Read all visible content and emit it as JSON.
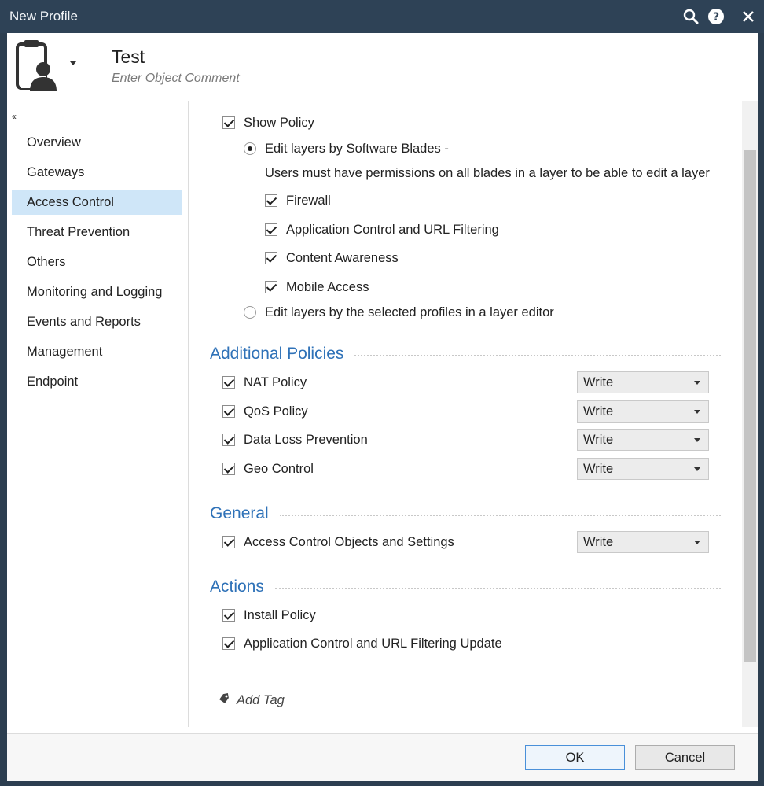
{
  "window": {
    "title": "New Profile",
    "icons": [
      "search-icon",
      "help-icon",
      "close-icon"
    ]
  },
  "header": {
    "object_name": "Test",
    "comment_placeholder": "Enter Object Comment"
  },
  "sidebar": {
    "collapse_glyph": "‹‹",
    "items": [
      {
        "label": "Overview"
      },
      {
        "label": "Gateways"
      },
      {
        "label": "Access Control",
        "active": true
      },
      {
        "label": "Threat Prevention"
      },
      {
        "label": "Others"
      },
      {
        "label": "Monitoring and Logging"
      },
      {
        "label": "Events and Reports"
      },
      {
        "label": "Management"
      },
      {
        "label": "Endpoint"
      }
    ]
  },
  "policy": {
    "show_policy": {
      "label": "Show Policy",
      "checked": true
    },
    "edit_by_blades": {
      "label": "Edit layers by Software Blades -",
      "selected": true
    },
    "blades_note": "Users must have permissions on all blades in a layer to be able to edit a layer",
    "blades": [
      {
        "label": "Firewall",
        "checked": true
      },
      {
        "label": "Application Control and URL Filtering",
        "checked": true
      },
      {
        "label": "Content Awareness",
        "checked": true
      },
      {
        "label": "Mobile Access",
        "checked": true
      }
    ],
    "edit_by_profiles": {
      "label": "Edit layers by the selected profiles in a layer editor",
      "selected": false
    }
  },
  "additional_policies": {
    "title": "Additional Policies",
    "items": [
      {
        "label": "NAT Policy",
        "checked": true,
        "permission": "Write"
      },
      {
        "label": "QoS Policy",
        "checked": true,
        "permission": "Write"
      },
      {
        "label": "Data Loss Prevention",
        "checked": true,
        "permission": "Write"
      },
      {
        "label": "Geo Control",
        "checked": true,
        "permission": "Write"
      }
    ]
  },
  "general": {
    "title": "General",
    "items": [
      {
        "label": "Access Control Objects and Settings",
        "checked": true,
        "permission": "Write"
      }
    ]
  },
  "actions": {
    "title": "Actions",
    "items": [
      {
        "label": "Install Policy",
        "checked": true
      },
      {
        "label": "Application Control and URL Filtering Update",
        "checked": true
      }
    ]
  },
  "tags": {
    "add_tag_label": "Add Tag"
  },
  "footer": {
    "ok_label": "OK",
    "cancel_label": "Cancel"
  },
  "colors": {
    "accent": "#2f72b8",
    "titlebar": "#2e4256",
    "selected_nav": "#cfe6f8"
  }
}
